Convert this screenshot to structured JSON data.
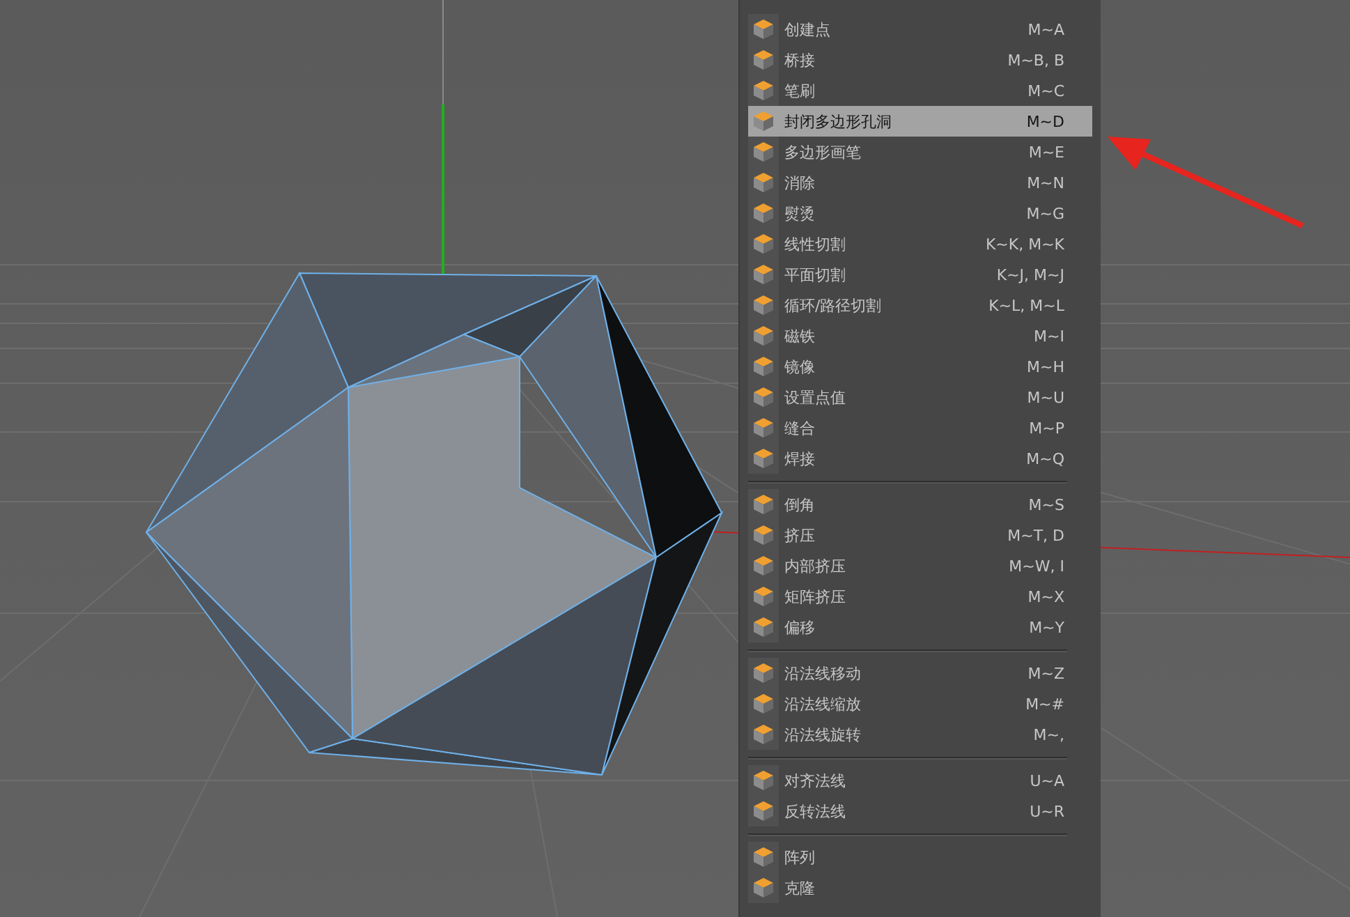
{
  "context_menu": {
    "groups": [
      {
        "items": [
          {
            "label": "创建点",
            "shortcut": "M~A",
            "selected": false
          },
          {
            "label": "桥接",
            "shortcut": "M~B, B",
            "selected": false
          },
          {
            "label": "笔刷",
            "shortcut": "M~C",
            "selected": false
          },
          {
            "label": "封闭多边形孔洞",
            "shortcut": "M~D",
            "selected": true
          },
          {
            "label": "多边形画笔",
            "shortcut": "M~E",
            "selected": false
          },
          {
            "label": "消除",
            "shortcut": "M~N",
            "selected": false
          },
          {
            "label": "熨烫",
            "shortcut": "M~G",
            "selected": false
          },
          {
            "label": "线性切割",
            "shortcut": "K~K, M~K",
            "selected": false
          },
          {
            "label": "平面切割",
            "shortcut": "K~J, M~J",
            "selected": false
          },
          {
            "label": "循环/路径切割",
            "shortcut": "K~L, M~L",
            "selected": false
          },
          {
            "label": "磁铁",
            "shortcut": "M~I",
            "selected": false
          },
          {
            "label": "镜像",
            "shortcut": "M~H",
            "selected": false
          },
          {
            "label": "设置点值",
            "shortcut": "M~U",
            "selected": false
          },
          {
            "label": "缝合",
            "shortcut": "M~P",
            "selected": false
          },
          {
            "label": "焊接",
            "shortcut": "M~Q",
            "selected": false
          }
        ]
      },
      {
        "items": [
          {
            "label": "倒角",
            "shortcut": "M~S",
            "selected": false
          },
          {
            "label": "挤压",
            "shortcut": "M~T, D",
            "selected": false
          },
          {
            "label": "内部挤压",
            "shortcut": "M~W, I",
            "selected": false
          },
          {
            "label": "矩阵挤压",
            "shortcut": "M~X",
            "selected": false
          },
          {
            "label": "偏移",
            "shortcut": "M~Y",
            "selected": false
          }
        ]
      },
      {
        "items": [
          {
            "label": "沿法线移动",
            "shortcut": "M~Z",
            "selected": false
          },
          {
            "label": "沿法线缩放",
            "shortcut": "M~#",
            "selected": false
          },
          {
            "label": "沿法线旋转",
            "shortcut": "M~,",
            "selected": false
          }
        ]
      },
      {
        "items": [
          {
            "label": "对齐法线",
            "shortcut": "U~A",
            "selected": false
          },
          {
            "label": "反转法线",
            "shortcut": "U~R",
            "selected": false
          }
        ]
      },
      {
        "items": [
          {
            "label": "阵列",
            "selected": false
          },
          {
            "label": "克隆",
            "selected": false
          }
        ]
      }
    ]
  }
}
